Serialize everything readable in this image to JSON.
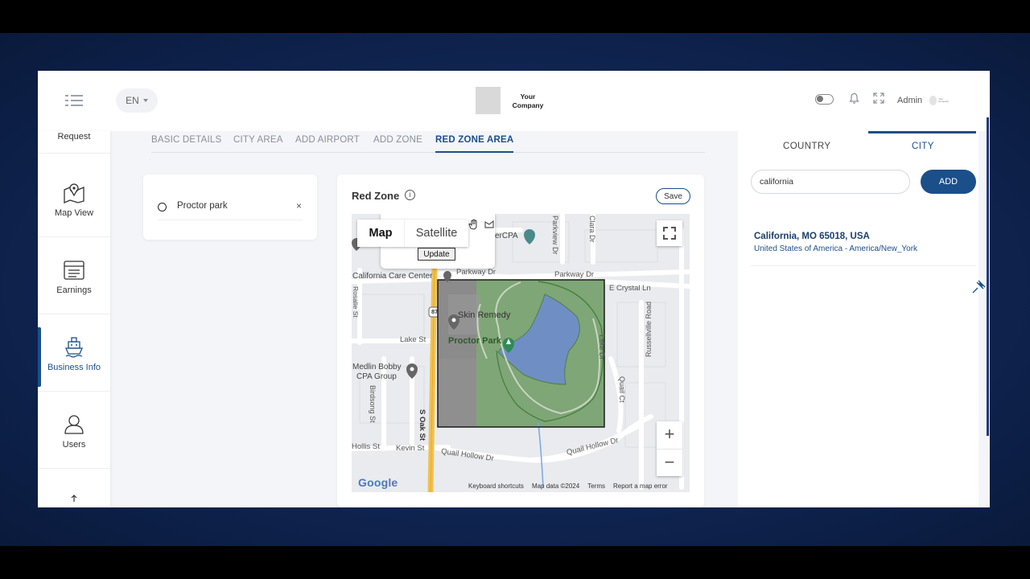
{
  "header": {
    "language": "EN",
    "company_name": "Your Company",
    "admin_label": "Admin",
    "avatar_text": "Your Company"
  },
  "sidebar": {
    "items": [
      {
        "label": "Request",
        "icon": "request-icon"
      },
      {
        "label": "Map View",
        "icon": "map-pin-icon"
      },
      {
        "label": "Earnings",
        "icon": "ledger-icon"
      },
      {
        "label": "Business Info",
        "icon": "ship-icon",
        "active": true
      },
      {
        "label": "Users",
        "icon": "user-icon"
      }
    ]
  },
  "tabs": [
    {
      "label": "BASIC DETAILS"
    },
    {
      "label": "CITY AREA"
    },
    {
      "label": "ADD AIRPORT"
    },
    {
      "label": "ADD ZONE"
    },
    {
      "label": "RED ZONE AREA",
      "active": true
    }
  ],
  "zone_list": {
    "items": [
      {
        "name": "Proctor park",
        "remove": "×"
      }
    ]
  },
  "red_zone": {
    "title": "Red Zone",
    "info": "i",
    "save_label": "Save",
    "map": {
      "type_map": "Map",
      "type_satellite": "Satellite",
      "update_label": "Update",
      "zoom_in": "+",
      "zoom_out": "−",
      "google_logo": "Google",
      "keyboard_shortcuts": "Keyboard shortcuts",
      "map_data": "Map data ©2024",
      "terms": "Terms",
      "report": "Report a map error",
      "labels": {
        "parkway1": "Parkway Dr",
        "parkway2": "Parkway Dr",
        "care_center": "California Care Center",
        "cpa": "erCPA",
        "skin": "Skin Remedy",
        "proctor": "Proctor Park",
        "lake_st": "Lake St",
        "medlin1": "Medlin Bobby",
        "medlin2": "CPA Group",
        "crystal": "E Crystal Ln",
        "russellville": "Russellville Road",
        "oak": "S Oak St",
        "birdsong": "Birdsong St",
        "hollis": "Hollis St",
        "kevin": "Kevin St",
        "quail1": "Quail Hollow Dr",
        "quail2": "Quail Hollow Dr",
        "quail_ct": "Quail Ct",
        "lake_dr": "Lake Dr",
        "parkview": "Parkview Dr",
        "clara": "Clara Dr",
        "rosalie": "Rosalie St",
        "shield": "87"
      }
    },
    "colors": {
      "park": "#7fa676",
      "lake": "#6f8fc4",
      "road_major": "#f2c14e",
      "selection_fill": "#8a8a8a"
    }
  },
  "location_panel": {
    "tab_country": "COUNTRY",
    "tab_city": "CITY",
    "active_tab": "CITY",
    "city_input_value": "california",
    "add_label": "ADD",
    "result": {
      "name": "California, MO 65018, USA",
      "detail": "United States of America - America/New_York"
    }
  },
  "theme": {
    "accent": "#1b4f8a",
    "backdrop": "#0f2450"
  }
}
